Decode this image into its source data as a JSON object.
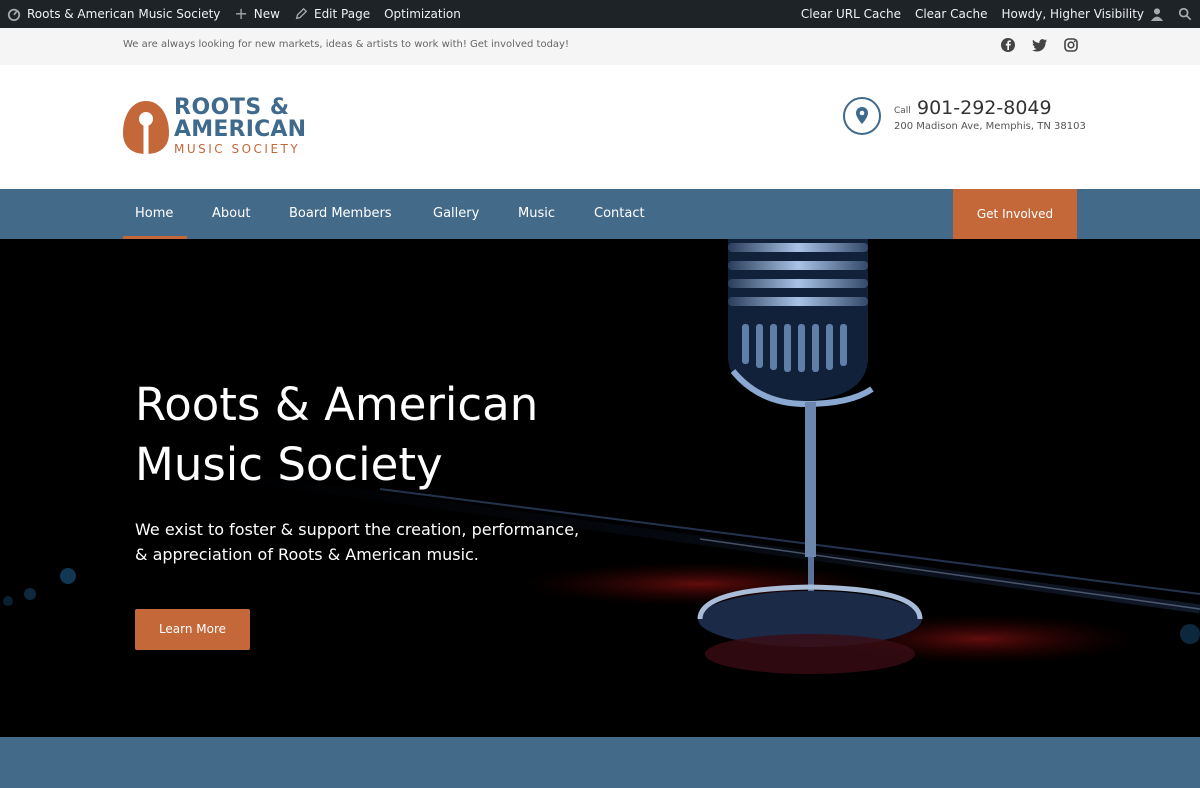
{
  "admin_bar": {
    "site_name": "Roots & American Music Society",
    "new_label": "New",
    "edit_label": "Edit Page",
    "optimization_label": "Optimization",
    "clear_url_cache": "Clear URL Cache",
    "clear_cache": "Clear Cache",
    "howdy": "Howdy, Higher Visibility"
  },
  "top_strip": {
    "message": "We are always looking for new markets, ideas & artists to work with! Get involved today!"
  },
  "social_icons": [
    "facebook-icon",
    "twitter-icon",
    "instagram-icon"
  ],
  "logo": {
    "line1": "ROOTS &",
    "line2": "AMERICAN",
    "line3": "MUSIC SOCIETY"
  },
  "contact": {
    "call_label": "Call",
    "phone": "901-292-8049",
    "address": "200 Madison Ave, Memphis, TN 38103"
  },
  "nav": {
    "items": [
      "Home",
      "About",
      "Board Members",
      "Gallery",
      "Music",
      "Contact"
    ],
    "active": "Home",
    "cta": "Get Involved"
  },
  "hero": {
    "title_line1": "Roots & American",
    "title_line2": "Music Society",
    "subtitle_line1": "We exist to foster & support the creation, performance,",
    "subtitle_line2": "& appreciation of Roots & American music.",
    "button": "Learn More"
  },
  "colors": {
    "brand_blue": "#446a89",
    "brand_orange": "#c4683a",
    "admin_bar": "#1d2327"
  }
}
